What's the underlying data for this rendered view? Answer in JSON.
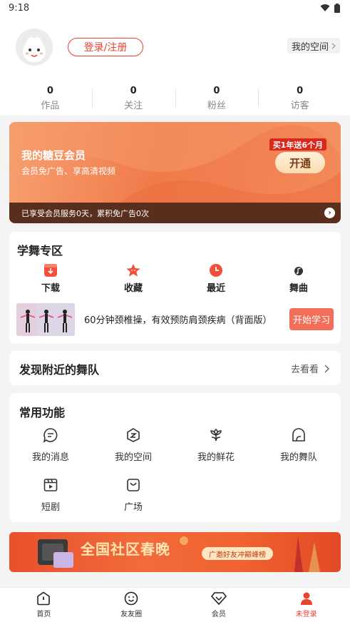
{
  "status_bar": {
    "time": "9:18"
  },
  "header": {
    "login_label": "登录/注册",
    "my_space_label": "我的空间",
    "stats": [
      {
        "value": "0",
        "label": "作品"
      },
      {
        "value": "0",
        "label": "关注"
      },
      {
        "value": "0",
        "label": "粉丝"
      },
      {
        "value": "0",
        "label": "访客"
      }
    ]
  },
  "vip": {
    "title": "我的糖豆会员",
    "subtitle": "会员免广告、享高清视频",
    "promo_badge": "买1年送6个月",
    "open_label": "开通",
    "status_text": "已享受会员服务0天，累积免广告0次"
  },
  "dance_zone": {
    "title": "学舞专区",
    "items": [
      {
        "label": "下载",
        "icon": "download-icon"
      },
      {
        "label": "收藏",
        "icon": "star-icon"
      },
      {
        "label": "最近",
        "icon": "clock-icon"
      },
      {
        "label": "舞曲",
        "icon": "music-note-icon"
      }
    ],
    "lesson": {
      "title": "60分钟颈椎操，有效预防肩颈疾病（背面版）",
      "button_label": "开始学习"
    }
  },
  "nearby": {
    "title": "发现附近的舞队",
    "link_label": "去看看"
  },
  "functions": {
    "title": "常用功能",
    "items": [
      {
        "label": "我的消息",
        "icon": "message-icon"
      },
      {
        "label": "我的空间",
        "icon": "space-icon"
      },
      {
        "label": "我的鲜花",
        "icon": "flower-icon"
      },
      {
        "label": "我的舞队",
        "icon": "team-icon"
      },
      {
        "label": "短剧",
        "icon": "film-icon"
      },
      {
        "label": "广场",
        "icon": "bag-icon"
      }
    ]
  },
  "banner": {
    "title": "全国社区春晚",
    "pill_text": "广邀好友冲巅峰榜"
  },
  "bottom_nav": {
    "items": [
      {
        "label": "首页",
        "icon": "home-icon"
      },
      {
        "label": "友友圈",
        "icon": "smile-icon"
      },
      {
        "label": "会员",
        "icon": "diamond-icon"
      },
      {
        "label": "未登录",
        "icon": "user-icon"
      }
    ],
    "active_color": "#e8432f"
  },
  "colors": {
    "accent": "#e8432f",
    "vip_orange": "#f07a4a",
    "lesson_button": "#f26e58"
  }
}
